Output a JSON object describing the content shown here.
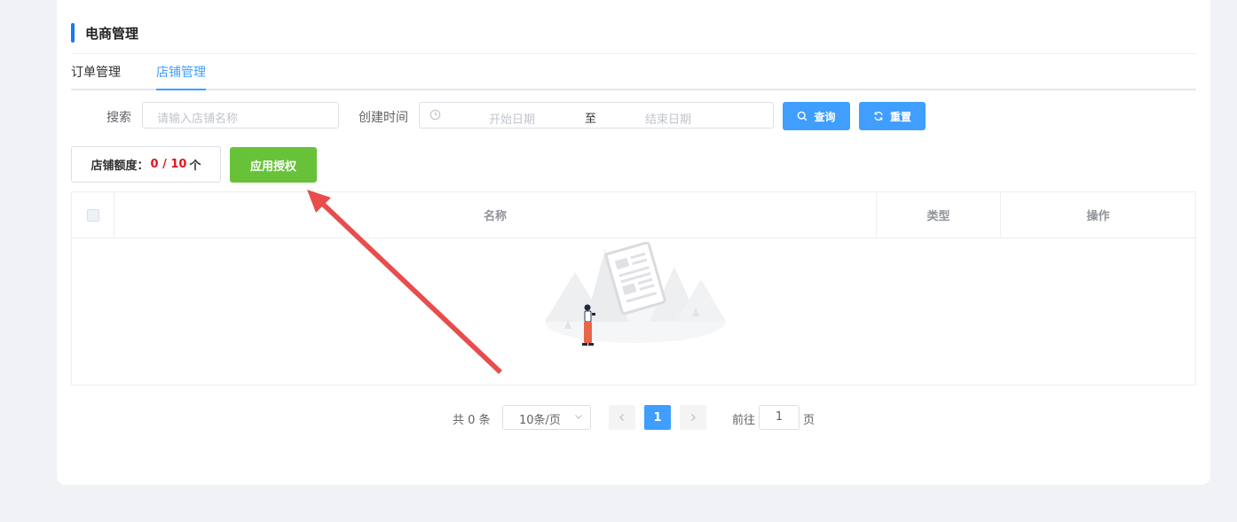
{
  "header": {
    "title": "电商管理"
  },
  "tabs": [
    {
      "label": "订单管理"
    },
    {
      "label": "店铺管理"
    }
  ],
  "filters": {
    "search_label": "搜索",
    "search_placeholder": "请输入店铺名称",
    "created_label": "创建时间",
    "start_placeholder": "开始日期",
    "range_separator": "至",
    "end_placeholder": "结束日期",
    "query_label": "查询",
    "reset_label": "重置"
  },
  "quota": {
    "label": "店铺额度：",
    "value": "0 / 10",
    "unit": "个"
  },
  "apply_auth_label": "应用授权",
  "table": {
    "columns": [
      "名称",
      "类型",
      "操作"
    ],
    "rows": []
  },
  "pagination": {
    "total_text": "共 0 条",
    "page_size": "10条/页",
    "current_page": "1",
    "goto_prefix": "前往",
    "goto_value": "1",
    "goto_suffix": "页"
  },
  "colors": {
    "primary": "#409eff",
    "success": "#67c23a",
    "danger": "#e6141d",
    "annotation_arrow": "#e84c4c"
  }
}
